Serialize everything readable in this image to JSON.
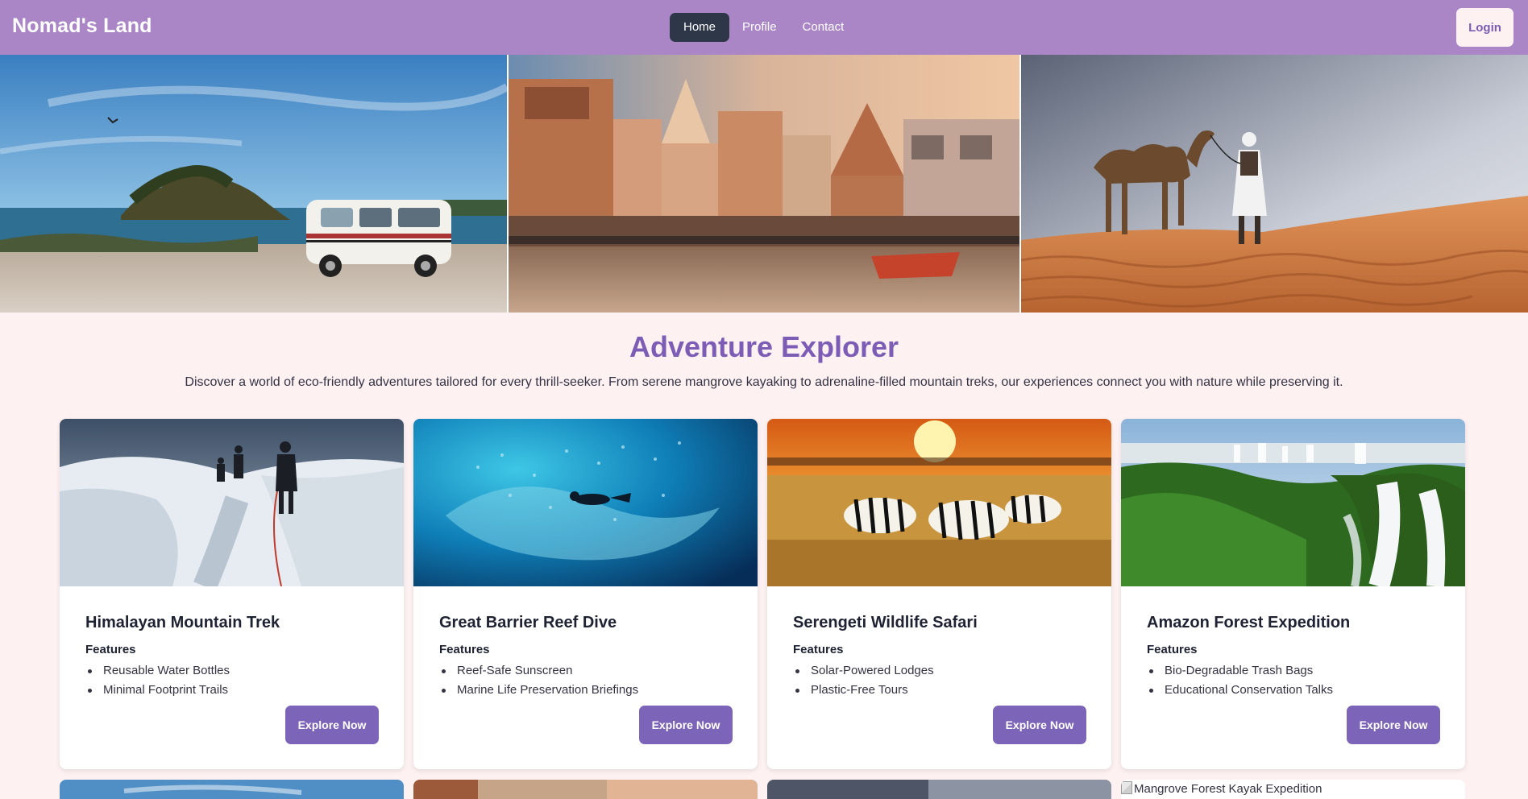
{
  "nav": {
    "brand": "Nomad's Land",
    "links": [
      {
        "label": "Home",
        "active": true
      },
      {
        "label": "Profile",
        "active": false
      },
      {
        "label": "Contact",
        "active": false
      }
    ],
    "login_label": "Login"
  },
  "hero": {
    "images": [
      {
        "icon": "beach-campervan-photo"
      },
      {
        "icon": "varanasi-ghats-photo"
      },
      {
        "icon": "desert-camel-photo"
      }
    ]
  },
  "main": {
    "title": "Adventure Explorer",
    "description": "Discover a world of eco-friendly adventures tailored for every thrill-seeker. From serene mangrove kayaking to adrenaline-filled mountain treks, our experiences connect you with nature while preserving it."
  },
  "cards": [
    {
      "title": "Himalayan Mountain Trek",
      "features_label": "Features",
      "features": [
        "Reusable Water Bottles",
        "Minimal Footprint Trails"
      ],
      "button": "Explore Now",
      "icon": "snow-trek-photo"
    },
    {
      "title": "Great Barrier Reef Dive",
      "features_label": "Features",
      "features": [
        "Reef-Safe Sunscreen",
        "Marine Life Preservation Briefings"
      ],
      "button": "Explore Now",
      "icon": "reef-diver-photo"
    },
    {
      "title": "Serengeti Wildlife Safari",
      "features_label": "Features",
      "features": [
        "Solar-Powered Lodges",
        "Plastic-Free Tours"
      ],
      "button": "Explore Now",
      "icon": "zebra-safari-photo"
    },
    {
      "title": "Amazon Forest Expedition",
      "features_label": "Features",
      "features": [
        "Bio-Degradable Trash Bags",
        "Educational Conservation Talks"
      ],
      "button": "Explore Now",
      "icon": "rainforest-waterfall-photo"
    }
  ],
  "next_row": {
    "broken_image_alt": "Mangrove Forest Kayak Expedition"
  },
  "colors": {
    "navbar": "#ab86c7",
    "background": "#fdf1f2",
    "accent": "#7c5cb4",
    "button": "#7c65b8",
    "active_nav": "#2d3748"
  }
}
